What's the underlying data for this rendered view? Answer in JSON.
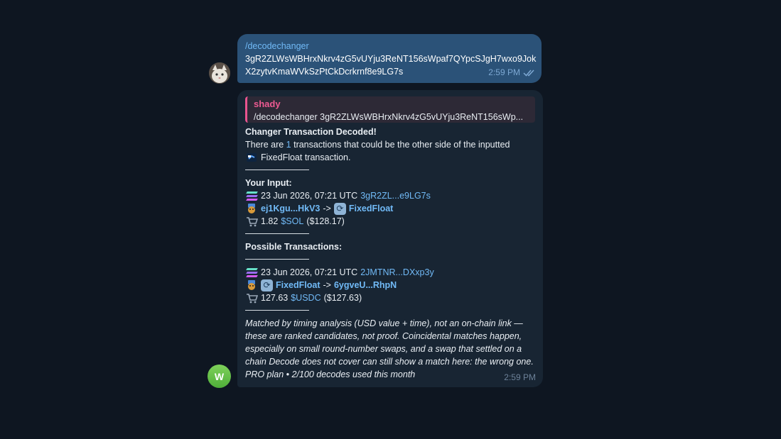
{
  "colors": {
    "background": "#0e1621",
    "outgoing_bubble": "#2b5278",
    "incoming_bubble": "#182533",
    "link": "#71baf7",
    "reply_accent": "#ee5a92"
  },
  "outgoing": {
    "command": "/decodechanger",
    "hash": "3gR2ZLWsWBHrxNkrv4zG5vUYju3ReNT156sWpaf7QYpcSJgH7wxo9JokX2zytvKmaWVkSzPtCkDcrkrnf8e9LG7s",
    "time": "2:59 PM",
    "status_icon": "double-check-icon"
  },
  "incoming": {
    "reply": {
      "name": "shady",
      "text": "/decodechanger 3gR2ZLWsWBHrxNkrv4zG5vUYju3ReNT156sWp..."
    },
    "heading": "Changer Transaction Decoded!",
    "intro_before": "There are ",
    "intro_count": "1",
    "intro_after": " transactions that could be the other side of the inputted",
    "intro_line2": "FixedFloat transaction.",
    "input_title": "Your Input:",
    "input": {
      "date": "23 Jun 2026, 07:21 UTC",
      "tx": "3gR2ZL...e9LG7s",
      "from": "ej1Kgu...HkV3",
      "arrow": "->",
      "to": "FixedFloat",
      "amount": "1.82",
      "token": "$SOL",
      "usd": "($128.17)"
    },
    "possible_title": "Possible Transactions:",
    "possible": {
      "date": "23 Jun 2026, 07:21 UTC",
      "tx": "2JMTNR...DXxp3y",
      "from": "FixedFloat",
      "arrow": "->",
      "to": "6ygveU...RhpN",
      "amount": "127.63",
      "token": "$USDC",
      "usd": "($127.63)"
    },
    "disclaimer": [
      "Matched by timing analysis (USD value + time), not an on-chain link —",
      "these are ranked candidates, not proof. Coincidental matches happen,",
      "especially on small round-number swaps, and a swap that settled on a",
      "chain Decode does not cover can still show a match here: the wrong one."
    ],
    "plan": "PRO plan • 2/100 decodes used this month",
    "time": "2:59 PM",
    "bot_initial": "W"
  }
}
